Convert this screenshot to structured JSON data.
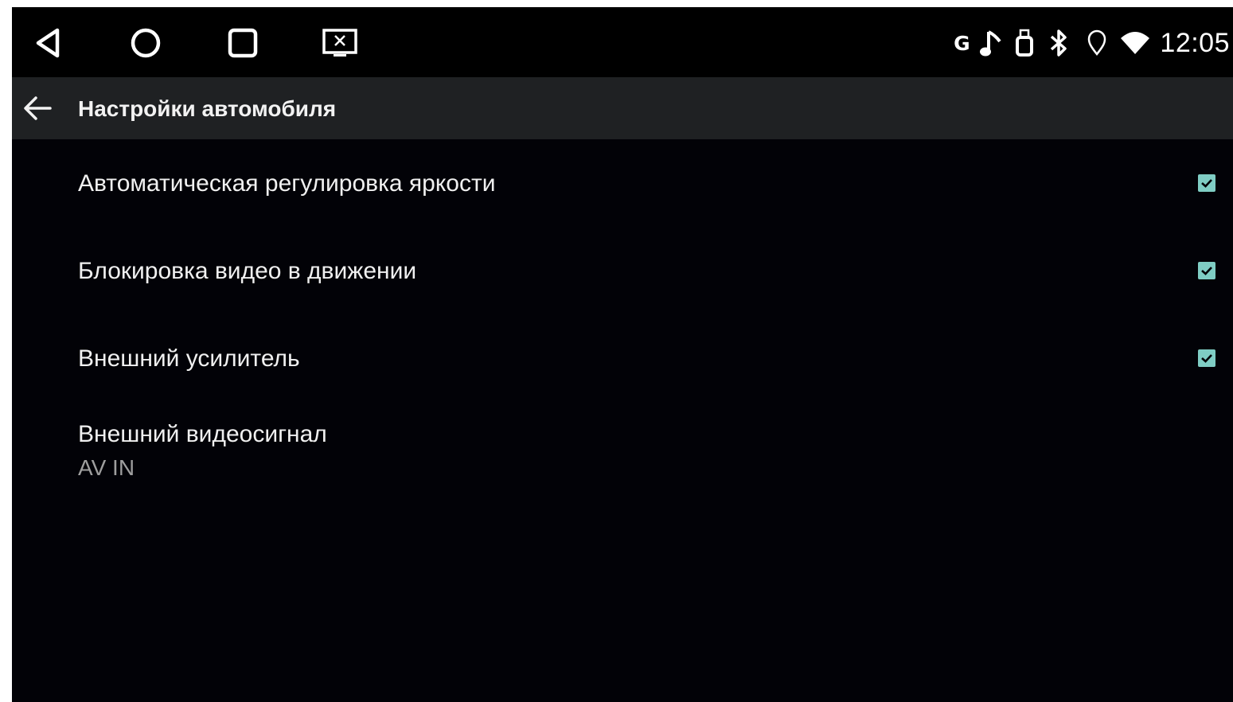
{
  "status_bar": {
    "nav": {
      "back_icon": "triangle-back-icon",
      "home_icon": "circle-home-icon",
      "recents_icon": "square-recents-icon",
      "screen_icon": "close-screen-icon"
    },
    "indicators": {
      "g_label": "G",
      "icons": [
        "g-icon",
        "music-note-icon",
        "usb-icon",
        "bluetooth-icon",
        "location-icon",
        "wifi-icon"
      ]
    },
    "time": "12:05"
  },
  "app_bar": {
    "back_icon": "arrow-left-icon",
    "title": "Настройки автомобиля"
  },
  "settings": [
    {
      "title": "Автоматическая регулировка яркости",
      "checked": true
    },
    {
      "title": "Блокировка видео в движении",
      "checked": true
    },
    {
      "title": "Внешний усилитель",
      "checked": true
    },
    {
      "title": "Внешний видеосигнал",
      "summary": "AV IN"
    }
  ],
  "colors": {
    "background": "#020207",
    "app_bar": "#1f2123",
    "checkbox_accent": "#7fcdc4",
    "summary_text": "#9e9e9e"
  }
}
